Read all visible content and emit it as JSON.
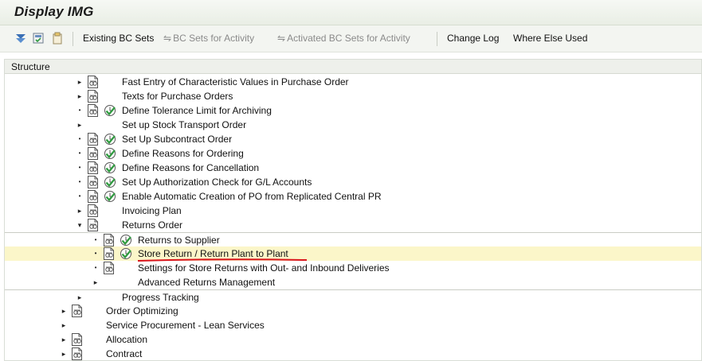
{
  "window": {
    "title": "Display IMG"
  },
  "toolbar": {
    "existing_bc_sets": "Existing BC Sets",
    "bc_sets_for_activity": "BC Sets for Activity",
    "activated_bc_sets_for_activity": "Activated BC Sets for Activity",
    "change_log": "Change Log",
    "where_else_used": "Where Else Used"
  },
  "structure": {
    "header": "Structure",
    "items": [
      {
        "label": "Fast Entry of Characteristic Values in Purchase Order",
        "level": 2,
        "control": "expand",
        "doc": true,
        "clock": false
      },
      {
        "label": "Texts for Purchase Orders",
        "level": 2,
        "control": "expand",
        "doc": true,
        "clock": false
      },
      {
        "label": "Define Tolerance Limit for Archiving",
        "level": 2,
        "control": "leaf",
        "doc": true,
        "clock": true
      },
      {
        "label": "Set up Stock Transport Order",
        "level": 2,
        "control": "expand",
        "doc": false,
        "clock": false
      },
      {
        "label": "Set Up Subcontract Order",
        "level": 2,
        "control": "leaf",
        "doc": true,
        "clock": true
      },
      {
        "label": "Define Reasons for Ordering",
        "level": 2,
        "control": "leaf",
        "doc": true,
        "clock": true
      },
      {
        "label": "Define Reasons for Cancellation",
        "level": 2,
        "control": "leaf",
        "doc": true,
        "clock": true
      },
      {
        "label": "Set Up Authorization Check for G/L Accounts",
        "level": 2,
        "control": "leaf",
        "doc": true,
        "clock": true
      },
      {
        "label": "Enable Automatic Creation of PO from Replicated Central PR",
        "level": 2,
        "control": "leaf",
        "doc": true,
        "clock": true
      },
      {
        "label": "Invoicing Plan",
        "level": 2,
        "control": "expand",
        "doc": true,
        "clock": false
      },
      {
        "label": "Returns Order",
        "level": 2,
        "control": "collapse",
        "doc": true,
        "clock": false
      },
      {
        "label": "Returns to Supplier",
        "level": 3,
        "control": "leaf",
        "doc": true,
        "clock": true
      },
      {
        "label": "Store Return / Return Plant to Plant",
        "level": 3,
        "control": "leaf",
        "doc": true,
        "clock": true,
        "highlighted": true
      },
      {
        "label": "Settings for Store Returns with Out- and Inbound Deliveries",
        "level": 3,
        "control": "leaf",
        "doc": true,
        "clock": false
      },
      {
        "label": "Advanced Returns Management",
        "level": 3,
        "control": "expand",
        "doc": false,
        "clock": false
      },
      {
        "label": "Progress Tracking",
        "level": 2,
        "control": "expand",
        "doc": false,
        "clock": false
      },
      {
        "label": "Order Optimizing",
        "level": 1,
        "control": "expand",
        "doc": true,
        "clock": false
      },
      {
        "label": "Service Procurement - Lean Services",
        "level": 1,
        "control": "expand",
        "doc": false,
        "clock": false
      },
      {
        "label": "Allocation",
        "level": 1,
        "control": "expand",
        "doc": true,
        "clock": false
      },
      {
        "label": "Contract",
        "level": 1,
        "control": "expand",
        "doc": true,
        "clock": false
      }
    ]
  },
  "colors": {
    "highlight_row": "#fbf6c9",
    "annotation_underline": "#d9141b",
    "clock_check": "#2e9a3e"
  },
  "icons": [
    "filter-icon",
    "save-variant-icon",
    "clipboard-icon",
    "bc-set-icon",
    "document-icon",
    "clock-check-icon"
  ]
}
